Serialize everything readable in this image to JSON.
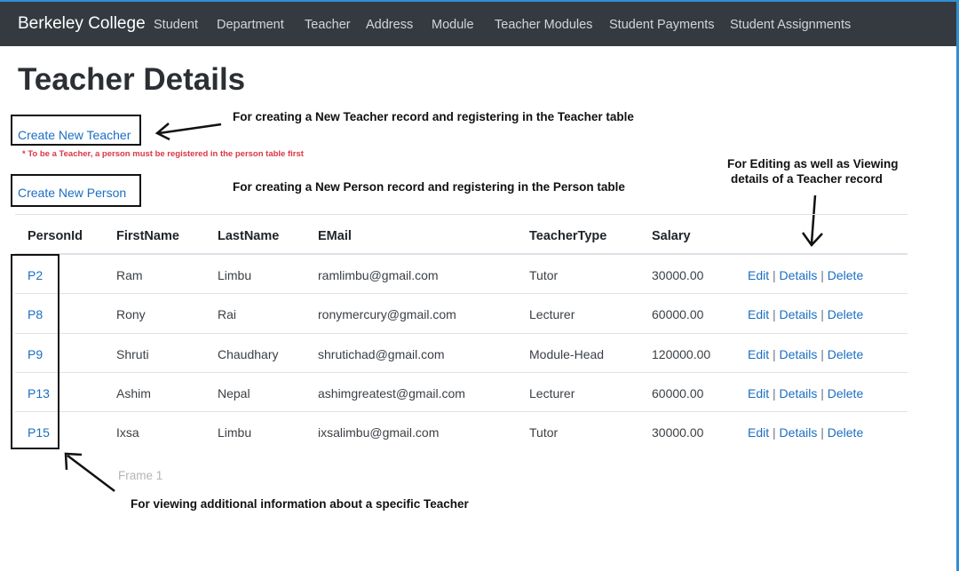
{
  "navbar": {
    "brand": "Berkeley College",
    "items": [
      "Student",
      "Department",
      "Teacher",
      "Address",
      "Module",
      "Teacher Modules",
      "Student Payments",
      "Student Assignments"
    ]
  },
  "page": {
    "title": "Teacher Details",
    "create_teacher_label": "Create New Teacher",
    "create_person_label": "Create New Person",
    "note": "* To be a Teacher, a person must be registered in the person table first",
    "frame_label": "Frame 1"
  },
  "annotations": {
    "create_teacher": "For creating a New Teacher record and registering in the Teacher table",
    "create_person": "For creating a New Person record and registering in the Person table",
    "edit_line1": "For Editing as well as Viewing",
    "edit_line2": "details of a Teacher record",
    "view_info": "For viewing additional information about a specific Teacher"
  },
  "table": {
    "headers": [
      "PersonId",
      "FirstName",
      "LastName",
      "EMail",
      "TeacherType",
      "Salary"
    ],
    "actions": {
      "edit": "Edit",
      "details": "Details",
      "delete": "Delete",
      "separator": "|"
    },
    "rows": [
      {
        "id": "P2",
        "first": "Ram",
        "last": "Limbu",
        "email": "ramlimbu@gmail.com",
        "type": "Tutor",
        "salary": "30000.00"
      },
      {
        "id": "P8",
        "first": "Rony",
        "last": "Rai",
        "email": "ronymercury@gmail.com",
        "type": "Lecturer",
        "salary": "60000.00"
      },
      {
        "id": "P9",
        "first": "Shruti",
        "last": "Chaudhary",
        "email": "shrutichad@gmail.com",
        "type": "Module-Head",
        "salary": "120000.00"
      },
      {
        "id": "P13",
        "first": "Ashim",
        "last": "Nepal",
        "email": "ashimgreatest@gmail.com",
        "type": "Lecturer",
        "salary": "60000.00"
      },
      {
        "id": "P15",
        "first": "Ixsa",
        "last": "Limbu",
        "email": "ixsalimbu@gmail.com",
        "type": "Tutor",
        "salary": "30000.00"
      }
    ]
  },
  "colors": {
    "navbar": "#343a40",
    "link": "#1b6ec2",
    "note": "#dc3545",
    "accent_border": "#2e8fd6"
  }
}
